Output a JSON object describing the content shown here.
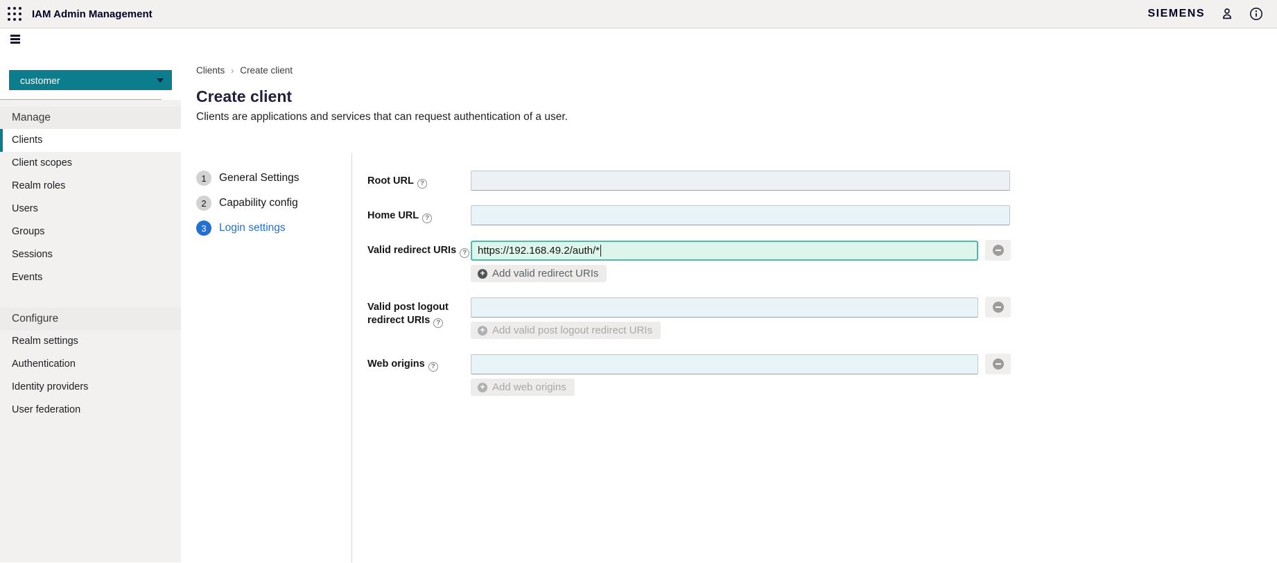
{
  "header": {
    "app_title": "IAM Admin Management",
    "brand": "SIEMENS"
  },
  "sidebar": {
    "realm_selector": {
      "value": "customer"
    },
    "sections": [
      {
        "label": "Manage",
        "items": [
          {
            "label": "Clients",
            "active": true
          },
          {
            "label": "Client scopes"
          },
          {
            "label": "Realm roles"
          },
          {
            "label": "Users"
          },
          {
            "label": "Groups"
          },
          {
            "label": "Sessions"
          },
          {
            "label": "Events"
          }
        ]
      },
      {
        "label": "Configure",
        "items": [
          {
            "label": "Realm settings"
          },
          {
            "label": "Authentication"
          },
          {
            "label": "Identity providers"
          },
          {
            "label": "User federation"
          }
        ]
      }
    ]
  },
  "breadcrumb": {
    "items": [
      "Clients",
      "Create client"
    ],
    "separator": "›"
  },
  "page": {
    "title": "Create client",
    "description": "Clients are applications and services that can request authentication of a user."
  },
  "wizard": {
    "steps": [
      {
        "number": "1",
        "label": "General Settings",
        "active": false
      },
      {
        "number": "2",
        "label": "Capability config",
        "active": false
      },
      {
        "number": "3",
        "label": "Login settings",
        "active": true
      }
    ]
  },
  "form": {
    "fields": {
      "root_url": {
        "label": "Root URL",
        "value": ""
      },
      "home_url": {
        "label": "Home URL",
        "value": ""
      },
      "valid_redirect_uris": {
        "label": "Valid redirect URIs",
        "value": "https://192.168.49.2/auth/*",
        "add_button": "Add valid redirect URIs"
      },
      "valid_post_logout_redirect_uris": {
        "label": "Valid post logout redirect URIs",
        "value": "",
        "add_button": "Add valid post logout redirect URIs"
      },
      "web_origins": {
        "label": "Web origins",
        "value": "",
        "add_button": "Add web origins"
      }
    }
  },
  "colors": {
    "accent_teal": "#0c7d8c",
    "active_step_blue": "#2470d2",
    "brand_navy": "#000028",
    "focused_input_border": "#4db8ac",
    "focused_input_bg": "#ddf5eb"
  }
}
